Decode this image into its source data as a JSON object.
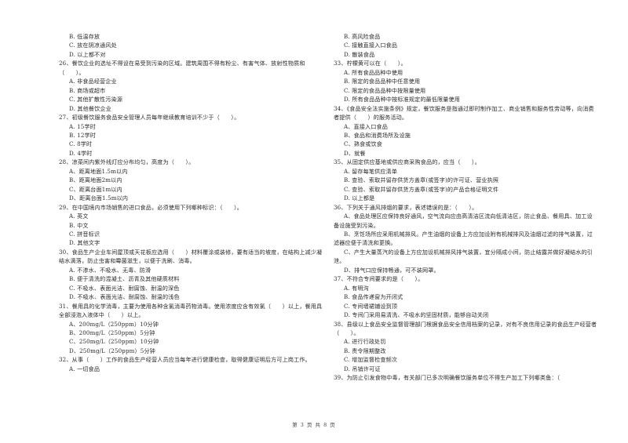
{
  "page": {
    "footer": "第 3 页 共 8 页"
  },
  "left_column": [
    {
      "type": "opt",
      "text": "B. 低温存放"
    },
    {
      "type": "opt",
      "text": "C. 放在阴凉通风处"
    },
    {
      "type": "opt",
      "text": "D. 以上都不对"
    },
    {
      "type": "q",
      "text": "26、餐饮企业的选址不得设在易受到污染的区域。建筑周围不得有粉尘、有害气体、放射性物质和（　　）。"
    },
    {
      "type": "opt",
      "text": "A. 非食品经营企业"
    },
    {
      "type": "opt",
      "text": "B. 商场或超市"
    },
    {
      "type": "opt",
      "text": "C. 其他扩散性污染源"
    },
    {
      "type": "opt",
      "text": "D. 其他餐饮企业"
    },
    {
      "type": "q",
      "text": "27、初级餐饮服务食品安全管理人员每年继续教育培训不少于（　　）。"
    },
    {
      "type": "opt",
      "text": "A. 15学时"
    },
    {
      "type": "opt",
      "text": "B. 12学时"
    },
    {
      "type": "opt",
      "text": "C. 8学时"
    },
    {
      "type": "opt",
      "text": "D. 4学时"
    },
    {
      "type": "q",
      "text": "28、凉菜间内紫外线灯应分布均匀，高度为（　　）。"
    },
    {
      "type": "opt",
      "text": "A、距离地面1.5m以内"
    },
    {
      "type": "opt",
      "text": "B、距离地面2m以内"
    },
    {
      "type": "opt",
      "text": "C、距离台面1m以内"
    },
    {
      "type": "opt",
      "text": "D、距离台面1.5m以内"
    },
    {
      "type": "q",
      "text": "29、在中国境内市场销售的进口食品，必须使用下列哪种标识：（　　）。"
    },
    {
      "type": "opt",
      "text": "A. 英文"
    },
    {
      "type": "opt",
      "text": "B. 中文"
    },
    {
      "type": "opt",
      "text": "C. 拼音标识"
    },
    {
      "type": "opt",
      "text": "D. 其他文字"
    },
    {
      "type": "q",
      "text": "30、食品生产企业车间屋顶或天花板应选用（　　）材料覆涂或装修，要有适当的坡度，在结构上减少凝结水滴落，防止虫害和霉菌滋生，以便于洗刷、消毒。"
    },
    {
      "type": "opt",
      "text": "A. 不渗水、不吸水、无毒、防滑"
    },
    {
      "type": "opt",
      "text": "B. 便于清洗的混凝土、沥青及其他硬质材料"
    },
    {
      "type": "opt",
      "text": "C. 不吸水、表面光洁、耐腐蚀、耐温的深色"
    },
    {
      "type": "opt",
      "text": "D. 不吸水、表面光洁、耐腐蚀、耐温的浅色"
    },
    {
      "type": "q",
      "text": "31、餐用具的化学消毒，主要为使用各种含氯消毒药物消毒。使用浓度应含有效氯（　　）以上，餐用具全部浸泡入液体中（　　）以上。"
    },
    {
      "type": "opt",
      "text": "A、200mg/L（250ppm）10分钟"
    },
    {
      "type": "opt",
      "text": "B、200mg/L（250ppm）5分钟"
    },
    {
      "type": "opt",
      "text": "C、250mg/L（250ppm）10分钟"
    },
    {
      "type": "opt",
      "text": "D、250mg/L（250ppm）5分钟"
    },
    {
      "type": "q",
      "text": "32、从事（　　）工作的食品生产经营人员应当每年进行健康检查，取得健康证明后方可上岗工作。"
    },
    {
      "type": "opt",
      "text": "A. 一切食品"
    }
  ],
  "right_column": [
    {
      "type": "opt",
      "text": "B. 高风险食品"
    },
    {
      "type": "opt",
      "text": "C. 接触直接入口食品"
    },
    {
      "type": "opt",
      "text": "D. 散装食品"
    },
    {
      "type": "q",
      "text": "33、柠檬黄可以在（　　）。"
    },
    {
      "type": "opt",
      "text": "A. 所有食品品种中使用"
    },
    {
      "type": "opt",
      "text": "B. 限定的食品品种中任意使用"
    },
    {
      "type": "opt",
      "text": "C. 限定的食品品种中按限量使用"
    },
    {
      "type": "opt",
      "text": "D. 所有食品品种中按标准规定的最低限量使用"
    },
    {
      "type": "q",
      "text": "34、《食品安全法实施条例》规定，餐饮服务是指通过即时制作加工、商业销售和服务性劳动等，向消费者提供（　　）的服务活动。"
    },
    {
      "type": "opt",
      "text": "A、直接入口食品"
    },
    {
      "type": "opt",
      "text": "B、食品和消费场所及设施"
    },
    {
      "type": "opt",
      "text": "C、熟食或饮食"
    },
    {
      "type": "opt",
      "text": "D、就餐"
    },
    {
      "type": "q",
      "text": "35、从固定供应基地或供应商采购食品的，应当（　　）。"
    },
    {
      "type": "opt",
      "text": "A. 留存每笔供应清单"
    },
    {
      "type": "opt",
      "text": "B. 查验、索取并留存供货方盖章(或签字)的许可证、营业执照"
    },
    {
      "type": "opt",
      "text": "C. 查验、索取并留存供货方盖章(或签字)的产品合格证明文件"
    },
    {
      "type": "opt",
      "text": "D. 以上都是"
    },
    {
      "type": "q",
      "text": "36、下列关于通风排烟的要求，表述错误的是：（　　）。"
    },
    {
      "type": "para",
      "text": "A、食品处理区应保持良好通风，空气流向应由高清洁区流向低清洁区，防止食品、餐用具、加工设备设施受到污染。"
    },
    {
      "type": "para",
      "text": "B、烹饪场所应采用机械排风。产生油烟的设备上方应加设附有机械排风及油烟过滤的排气装置，过滤器应便于清洗和更换。"
    },
    {
      "type": "para",
      "text": "C、产生大量蒸汽的设备上方应加设机械排风排气装置，宜分隔成小间，防止结露并做好凝结水的引泄。"
    },
    {
      "type": "para",
      "text": "D、排气口应保持畅通，可不装网罩。"
    },
    {
      "type": "q",
      "text": "37、不符合专间要求的是（　　）。"
    },
    {
      "type": "opt",
      "text": "A. 有明沟"
    },
    {
      "type": "opt",
      "text": "B. 食品传递窗为开闭式"
    },
    {
      "type": "opt",
      "text": "C. 专间墙裙铺设到顶"
    },
    {
      "type": "opt",
      "text": "D. 专间门采用易清洗、不吸水的坚固材质，能够自动关闭"
    },
    {
      "type": "q",
      "text": "38、县级以上食品安全监督管理部门根据食品安全信用档案的记录，对有不良信用记录的食品生产经营者（　　）。"
    },
    {
      "type": "opt",
      "text": "A. 进行行政处罚"
    },
    {
      "type": "opt",
      "text": "B. 责令限期整改"
    },
    {
      "type": "opt",
      "text": "C. 增加监督检查频次"
    },
    {
      "type": "opt",
      "text": "D. 吊销许可证"
    },
    {
      "type": "q",
      "text": "39、为防止引发食物中毒，有关部门已多次明确餐饮服务单位不得生产加工下列哪类鱼：（"
    }
  ]
}
